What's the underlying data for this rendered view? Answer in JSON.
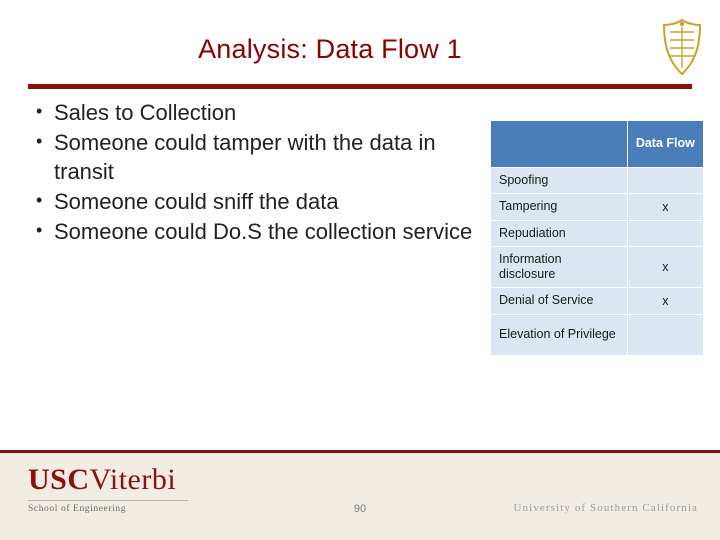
{
  "slide": {
    "title": "Analysis: Data Flow 1",
    "number": "90"
  },
  "bullets": [
    "Sales to Collection",
    "Someone could tamper with the data in transit",
    "Someone could sniff the data",
    "Someone could Do.S the collection service"
  ],
  "stride_table": {
    "corner_label": "",
    "column_header": "Data Flow",
    "rows": [
      {
        "threat": "Spoofing",
        "mark": ""
      },
      {
        "threat": "Tampering",
        "mark": "x"
      },
      {
        "threat": "Repudiation",
        "mark": ""
      },
      {
        "threat": "Information disclosure",
        "mark": "x"
      },
      {
        "threat": "Denial of Service",
        "mark": "x"
      },
      {
        "threat": "Elevation of Privilege",
        "mark": ""
      }
    ]
  },
  "footer": {
    "logo_usc": "USC",
    "logo_viterbi": "Viterbi",
    "logo_sub": "School of Engineering",
    "right_text": "University of Southern California"
  },
  "colors": {
    "title": "#8B0000",
    "rule": "#8B1111",
    "table_header": "#4A7EBB",
    "table_cell": "#DCE6F2"
  }
}
